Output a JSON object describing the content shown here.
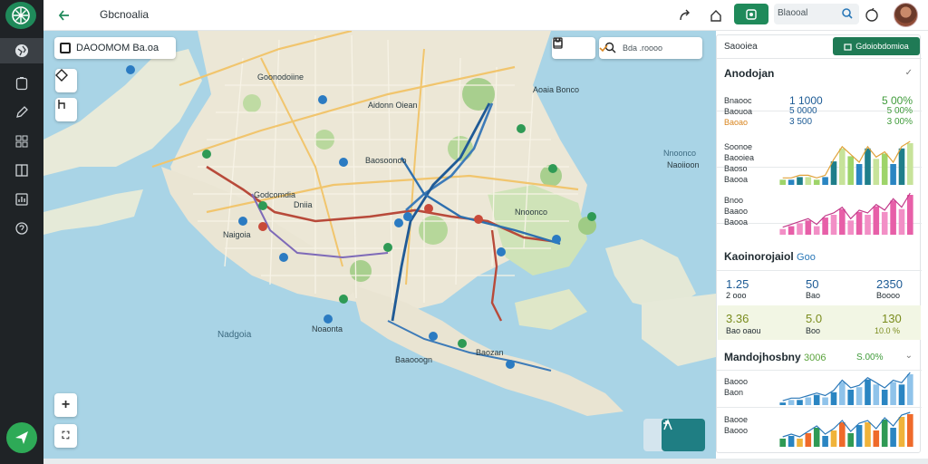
{
  "topbar": {
    "title": "Gbcnoalia",
    "search_text": "Blaooal"
  },
  "icons": {
    "logo": "compass-logo-icon",
    "back": "arrow-left-icon",
    "share": "share-icon",
    "home": "home-icon",
    "toggle": "toggle-icon",
    "search": "search-icon",
    "help": "help-icon",
    "avatar": "avatar-icon"
  },
  "rail": {
    "items": [
      "layers",
      "info",
      "edit",
      "grid",
      "columns",
      "analytics",
      "help"
    ]
  },
  "map": {
    "place_card": "DAOOMOM Ba.oa",
    "search_text": "Bda .roooo",
    "labels": [
      "Goonodoiine",
      "Aidonn Oiean",
      "Baosoonoo",
      "Godcomdia",
      "Dniia",
      "Naigoia",
      "Noaonta",
      "Aoaia Bonco",
      "Baozan",
      "Nnoonco",
      "Baaooogn",
      "Naoiioon"
    ],
    "water_labels": [
      "Nadgoia",
      "Nnoonco"
    ]
  },
  "panel": {
    "header_title": "Saooiea",
    "header_button": "Gdoiobdomioa",
    "sections": [
      {
        "title": "Anodojan",
        "labels": [
          "Bnaooc",
          "Baouoa",
          "Baoao"
        ],
        "stats_a": [
          "1 1000",
          "5 0000",
          "3 500"
        ],
        "stats_b": [
          "5 00%",
          "5 00%",
          "3 00%"
        ]
      },
      {
        "title": "Soonoe",
        "labels": [
          "Baooiea",
          "Baoso",
          "Baooa"
        ]
      },
      {
        "title": "",
        "labels": [
          "Bnoo",
          "Baaoo",
          "Baooa"
        ]
      },
      {
        "title": "Kaoinorojaiol",
        "accent": "Goo",
        "stats_row1": [
          {
            "value": "1.25",
            "sub": "2 ooo"
          },
          {
            "value": "50",
            "sub": "Bao"
          },
          {
            "value": "2350",
            "sub": "Boooo"
          }
        ],
        "stats_row2": [
          {
            "value": "3.36",
            "sub": "Bao oaou"
          },
          {
            "value": "5.0",
            "sub": "Boo"
          },
          {
            "value": "130",
            "sub": "10.0 %"
          }
        ]
      },
      {
        "title": "Mandojhosbny",
        "accent": "3006",
        "accent2": "S.00%",
        "labels": [
          "Baooo",
          "Baon",
          "Baooo"
        ],
        "labels2": [
          "Baooe",
          "Baooo"
        ]
      }
    ]
  },
  "chart_data": [
    {
      "type": "bar",
      "values": [
        2,
        2,
        3,
        3,
        2,
        3,
        9,
        14,
        11,
        8,
        14,
        10,
        12,
        8,
        14,
        16
      ]
    },
    {
      "type": "bar",
      "values": [
        2,
        3,
        4,
        5,
        3,
        6,
        7,
        9,
        5,
        8,
        7,
        10,
        8,
        12,
        9,
        14
      ]
    },
    {
      "type": "bar",
      "values": [
        1,
        2,
        2,
        3,
        4,
        3,
        5,
        9,
        6,
        7,
        10,
        8,
        6,
        9,
        8,
        12
      ]
    },
    {
      "type": "bar",
      "values": [
        3,
        4,
        3,
        5,
        7,
        4,
        6,
        9,
        5,
        8,
        9,
        6,
        10,
        7,
        11,
        12
      ]
    }
  ],
  "colors": {
    "rail": "#1f2326",
    "accent_green": "#1f8a5a",
    "chart_green": "#9ed46a",
    "chart_blue": "#2a85c2",
    "chart_pink": "#e75fa8",
    "chart_orange": "#ef8a2a"
  }
}
